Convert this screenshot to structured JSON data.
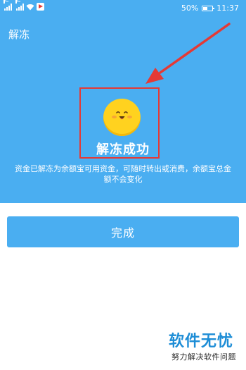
{
  "status_bar": {
    "signal_1_label": "2G",
    "signal_2_label": "4G",
    "battery_level": "50%",
    "battery_fill": 0.5,
    "time": "11:37"
  },
  "page": {
    "title": "解冻"
  },
  "result": {
    "title": "解冻成功",
    "description": "资金已解冻为余额宝可用资金，可随时转出或消费，余额宝总金额不会变化"
  },
  "actions": {
    "done_label": "完成"
  },
  "watermark": {
    "title": "软件无忧",
    "subtitle": "努力解决软件问题"
  },
  "colors": {
    "brand_blue": "#4aaef1",
    "annotation_red": "#e53935",
    "smiley_yellow": "#ffd21f",
    "watermark_blue": "#1d8dd6"
  }
}
